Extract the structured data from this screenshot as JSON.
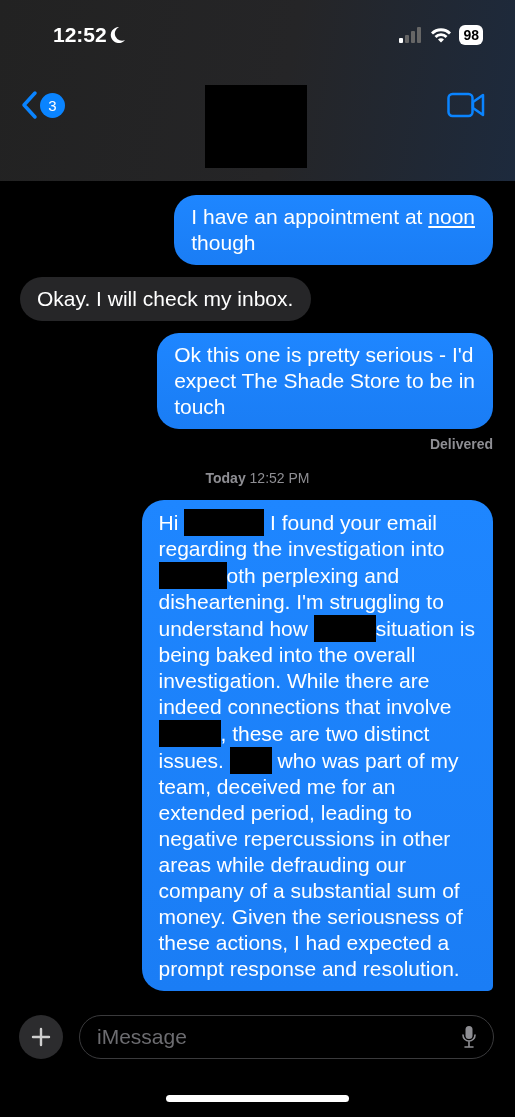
{
  "status_bar": {
    "time": "12:52",
    "battery": "98"
  },
  "header": {
    "back_badge": "3"
  },
  "messages": [
    {
      "kind": "sent",
      "tail": false,
      "lines": [
        [
          {
            "kind": "text",
            "text": "I have an appointment at "
          },
          {
            "kind": "link",
            "text": "noon"
          }
        ],
        [
          {
            "kind": "text",
            "text": "though"
          }
        ]
      ]
    },
    {
      "kind": "received",
      "tail": false,
      "lines": [
        [
          {
            "kind": "text",
            "text": "Okay. I will check my inbox."
          }
        ]
      ]
    },
    {
      "kind": "sent",
      "tail": false,
      "status": "Delivered",
      "lines": [
        [
          {
            "kind": "text",
            "text": "Ok this one is pretty serious - I'd"
          }
        ],
        [
          {
            "kind": "text",
            "text": "expect The Shade Store to be in"
          }
        ],
        [
          {
            "kind": "text",
            "text": "touch"
          }
        ]
      ]
    },
    {
      "kind": "timestamp",
      "text": "**Today** 12:52 PM"
    },
    {
      "kind": "sent",
      "tail": true,
      "lines": [
        [
          {
            "kind": "text",
            "text": "Hi "
          },
          {
            "kind": "redacted"
          },
          {
            "kind": "text",
            "text": " I found your email"
          }
        ],
        [
          {
            "kind": "text",
            "text": "regarding the investigation into"
          }
        ],
        [
          {
            "kind": "redacted"
          },
          {
            "kind": "text",
            "text": "oth perplexing and"
          }
        ],
        [
          {
            "kind": "text",
            "text": "disheartening. I'm struggling to"
          }
        ],
        [
          {
            "kind": "text",
            "text": "understand how "
          },
          {
            "kind": "redacted"
          },
          {
            "kind": "text",
            "text": "situation is"
          }
        ],
        [
          {
            "kind": "text",
            "text": "being baked into the overall"
          }
        ],
        [
          {
            "kind": "text",
            "text": "investigation. While there are"
          }
        ],
        [
          {
            "kind": "text",
            "text": "indeed connections that involve"
          }
        ],
        [
          {
            "kind": "redacted"
          },
          {
            "kind": "text",
            "text": ", these are two distinct"
          }
        ],
        [
          {
            "kind": "text",
            "text": "issues. "
          },
          {
            "kind": "redacted"
          },
          {
            "kind": "text",
            "text": " who was part of my"
          }
        ],
        [
          {
            "kind": "text",
            "text": "team, deceived me for an"
          }
        ],
        [
          {
            "kind": "text",
            "text": "extended period, leading to"
          }
        ],
        [
          {
            "kind": "text",
            "text": "negative repercussions in other"
          }
        ],
        [
          {
            "kind": "text",
            "text": "areas while defrauding our"
          }
        ],
        [
          {
            "kind": "text",
            "text": "company of a substantial sum of"
          }
        ],
        [
          {
            "kind": "text",
            "text": "money. Given the seriousness of"
          }
        ],
        [
          {
            "kind": "text",
            "text": "these actions, I had expected a"
          }
        ],
        [
          {
            "kind": "text",
            "text": "prompt response and resolution."
          }
        ]
      ]
    }
  ],
  "composer": {
    "placeholder": "iMessage"
  }
}
